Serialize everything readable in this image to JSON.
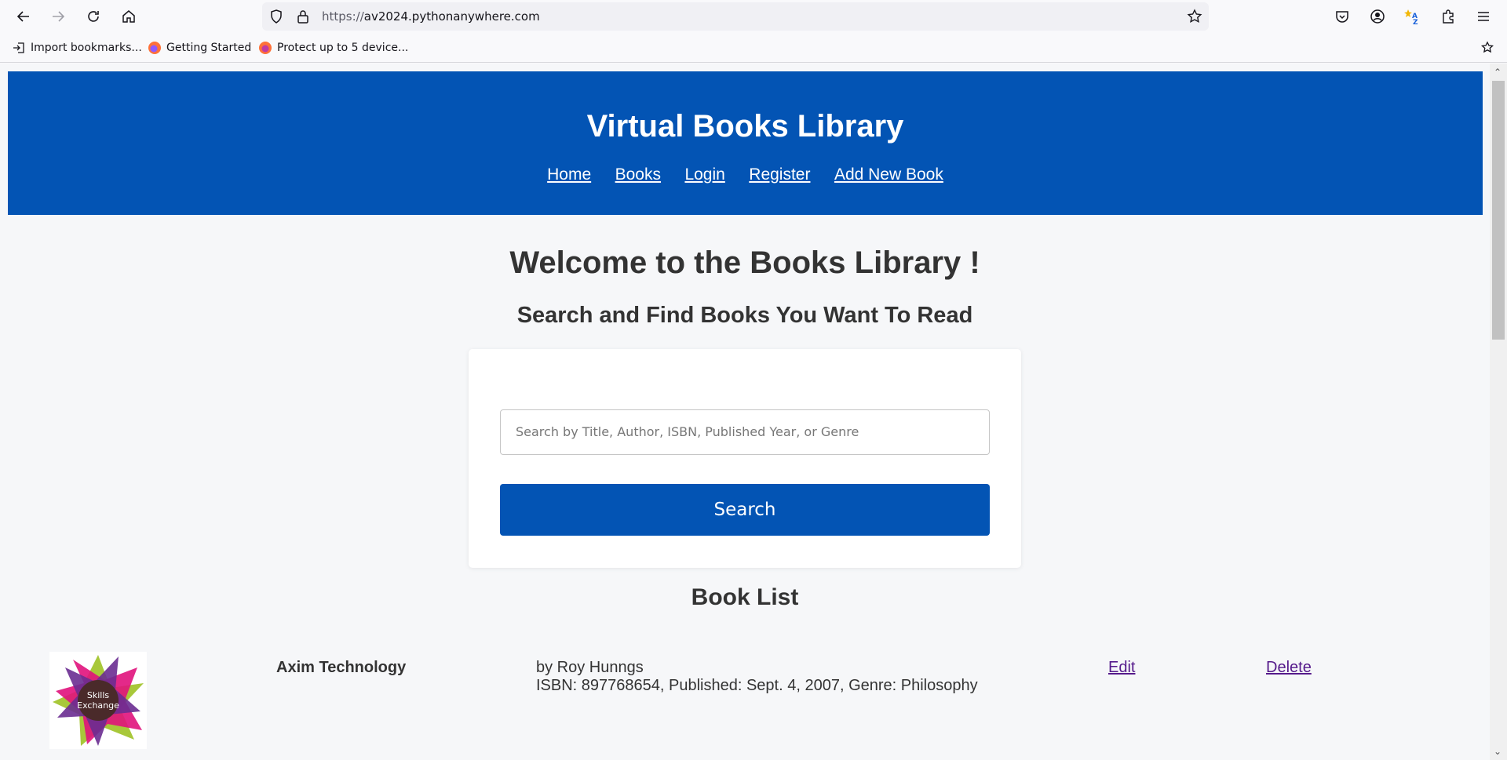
{
  "browser": {
    "url_scheme": "https://",
    "url_host": "av2024.pythonanywhere.com",
    "bookmarks": [
      {
        "label": "Import bookmarks..."
      },
      {
        "label": "Getting Started"
      },
      {
        "label": "Protect up to 5 device..."
      }
    ]
  },
  "header": {
    "title": "Virtual Books Library",
    "nav": [
      {
        "label": "Home"
      },
      {
        "label": "Books"
      },
      {
        "label": "Login"
      },
      {
        "label": "Register"
      },
      {
        "label": "Add New Book"
      }
    ]
  },
  "main": {
    "welcome": "Welcome to the Books Library !",
    "subtitle": "Search and Find Books You Want To Read",
    "search": {
      "placeholder": "Search by Title, Author, ISBN, Published Year, or Genre",
      "value": "",
      "button_label": "Search"
    },
    "book_list_title": "Book List",
    "books": [
      {
        "title": "Axim Technology",
        "author_line": "by Roy Hunngs",
        "details_line": "ISBN: 897768654, Published: Sept. 4, 2007, Genre: Philosophy",
        "edit_label": "Edit",
        "delete_label": "Delete",
        "cover_text_1": "Skills",
        "cover_text_2": "Exchange"
      }
    ]
  },
  "colors": {
    "brand_blue": "#0354b4",
    "visited_link": "#551a8b"
  }
}
